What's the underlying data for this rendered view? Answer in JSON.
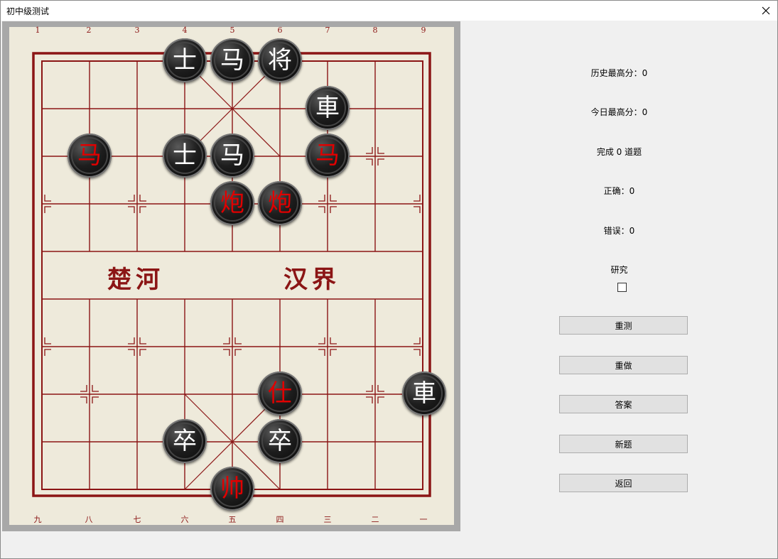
{
  "window": {
    "title": "初中级测试"
  },
  "board": {
    "top_numbers": [
      "1",
      "2",
      "3",
      "4",
      "5",
      "6",
      "7",
      "8",
      "9"
    ],
    "bottom_numbers": [
      "九",
      "八",
      "七",
      "六",
      "五",
      "四",
      "三",
      "二",
      "一"
    ],
    "river_left": "楚河",
    "river_right": "汉界",
    "colors": {
      "board_bg": "#eeeadb",
      "line": "#8b1515",
      "red_piece_text": "#e00000",
      "black_piece_text": "#ffffff"
    },
    "pieces": [
      {
        "char": "士",
        "color": "black",
        "file": 4,
        "rank": 1
      },
      {
        "char": "马",
        "color": "black",
        "file": 5,
        "rank": 1
      },
      {
        "char": "将",
        "color": "black",
        "file": 6,
        "rank": 1
      },
      {
        "char": "車",
        "color": "black",
        "file": 7,
        "rank": 2
      },
      {
        "char": "马",
        "color": "red",
        "file": 2,
        "rank": 3
      },
      {
        "char": "士",
        "color": "black",
        "file": 4,
        "rank": 3
      },
      {
        "char": "马",
        "color": "black",
        "file": 5,
        "rank": 3
      },
      {
        "char": "马",
        "color": "red",
        "file": 7,
        "rank": 3
      },
      {
        "char": "炮",
        "color": "red",
        "file": 5,
        "rank": 4
      },
      {
        "char": "炮",
        "color": "red",
        "file": 6,
        "rank": 4
      },
      {
        "char": "仕",
        "color": "red",
        "file": 6,
        "rank": 8
      },
      {
        "char": "車",
        "color": "black",
        "file": 9,
        "rank": 8
      },
      {
        "char": "卒",
        "color": "black",
        "file": 4,
        "rank": 9
      },
      {
        "char": "卒",
        "color": "black",
        "file": 6,
        "rank": 9
      },
      {
        "char": "帅",
        "color": "red",
        "file": 5,
        "rank": 10
      }
    ]
  },
  "stats": {
    "history_best": "历史最高分：0",
    "today_best": "今日最高分：0",
    "completed": "完成 0 道题",
    "correct": "正确：0",
    "wrong": "错误：0",
    "study_label": "研究"
  },
  "buttons": {
    "retest": "重测",
    "redo": "重做",
    "answer": "答案",
    "new_question": "新题",
    "back": "返回"
  }
}
